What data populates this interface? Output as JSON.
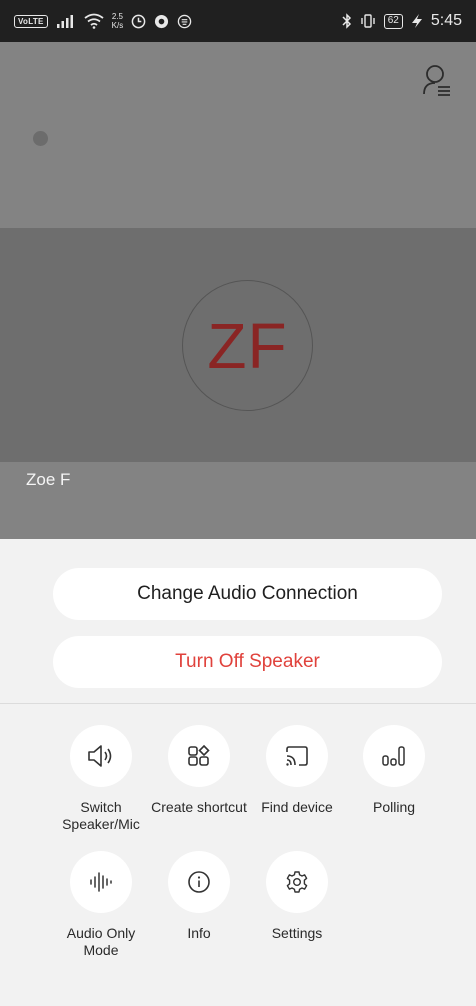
{
  "status_bar": {
    "volte": "VoLTE",
    "speed_value": "2.5",
    "speed_unit": "K/s",
    "battery": "62",
    "time": "5:45"
  },
  "meeting": {
    "avatar_initials": "ZF",
    "participant_name": "Zoe F",
    "avatar_text_color": "#8a2524"
  },
  "sheet": {
    "change_audio_label": "Change Audio Connection",
    "turn_off_speaker_label": "Turn Off Speaker",
    "turn_off_speaker_color": "#e0423c",
    "actions": [
      {
        "label": "Switch Speaker/Mic",
        "icon": "speaker-icon"
      },
      {
        "label": "Create shortcut",
        "icon": "shortcut-grid-icon"
      },
      {
        "label": "Find device",
        "icon": "cast-icon"
      },
      {
        "label": "Polling",
        "icon": "poll-bars-icon"
      },
      {
        "label": "Audio Only Mode",
        "icon": "waveform-icon"
      },
      {
        "label": "Info",
        "icon": "info-icon"
      },
      {
        "label": "Settings",
        "icon": "gear-icon"
      }
    ]
  }
}
